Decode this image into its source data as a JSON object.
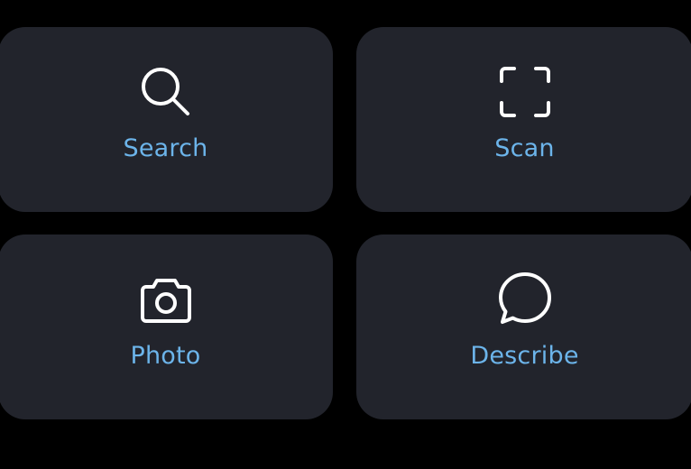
{
  "theme": {
    "background": "#000000",
    "tile_background": "#22242c",
    "label_color": "#6cb4ea",
    "icon_color": "#ffffff"
  },
  "actions": [
    {
      "label": "Search",
      "icon": "search-icon"
    },
    {
      "label": "Scan",
      "icon": "scan-frame-icon"
    },
    {
      "label": "Photo",
      "icon": "camera-icon"
    },
    {
      "label": "Describe",
      "icon": "speech-bubble-icon"
    }
  ]
}
